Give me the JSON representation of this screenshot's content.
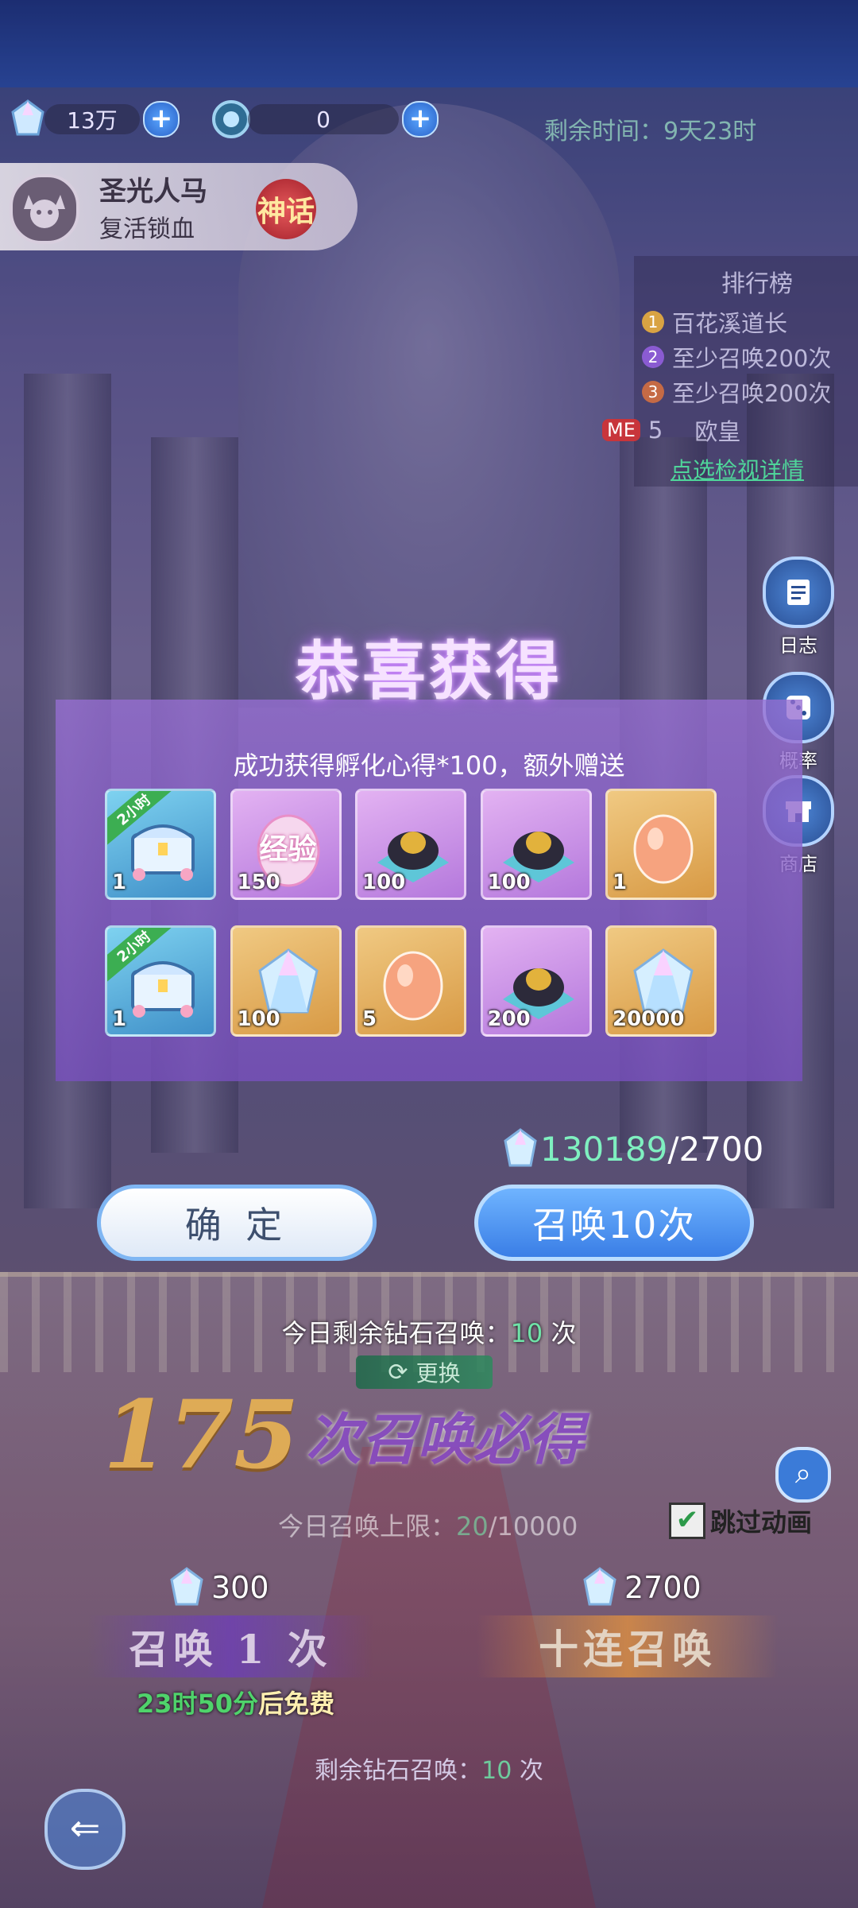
{
  "resources": {
    "gems": "13万",
    "tokens": "0",
    "timer_label": "剩余时间：",
    "timer_value": "9天23时"
  },
  "banner": {
    "name": "圣光人马",
    "subtitle": "复活锁血",
    "rarity": "神话"
  },
  "leaderboard": {
    "title": "排行榜",
    "rows": [
      {
        "rank": "1",
        "name": "百花溪道长",
        "color": "#d9a343"
      },
      {
        "rank": "2",
        "name": "至少召唤200次",
        "color": "#8a5bd2"
      },
      {
        "rank": "3",
        "name": "至少召唤200次",
        "color": "#c56a45"
      }
    ],
    "me_tag": "ME",
    "me_rank": "5",
    "me_name": "欧皇",
    "details_link": "点选检视详情"
  },
  "side_menu": [
    {
      "label": "日志",
      "icon": "log-icon"
    },
    {
      "label": "概率",
      "icon": "dice-icon"
    },
    {
      "label": "商店",
      "icon": "shop-icon"
    }
  ],
  "modal": {
    "title": "恭喜获得",
    "message": "成功获得孵化心得*100，额外赠送",
    "row1": [
      {
        "type": "chest",
        "bg": "blue",
        "count": "1",
        "tag": "2小时"
      },
      {
        "type": "exp-egg",
        "bg": "purple",
        "count": "150",
        "label": "经验"
      },
      {
        "type": "dark-ore",
        "bg": "purple",
        "count": "100"
      },
      {
        "type": "dark-ore",
        "bg": "purple",
        "count": "100"
      },
      {
        "type": "peach-egg",
        "bg": "gold",
        "count": "1"
      }
    ],
    "row2": [
      {
        "type": "chest",
        "bg": "blue",
        "count": "1",
        "tag": "2小时"
      },
      {
        "type": "crystal",
        "bg": "gold",
        "count": "100"
      },
      {
        "type": "peach-egg",
        "bg": "gold",
        "count": "5"
      },
      {
        "type": "dark-ore",
        "bg": "purple",
        "count": "200"
      },
      {
        "type": "crystal",
        "bg": "gold",
        "count": "20000"
      }
    ],
    "crystal_have": "130189",
    "crystal_need": "/2700",
    "confirm_label": "确 定",
    "summon_label": "召唤10次"
  },
  "summon": {
    "today_prefix": "今日剩余钻石召唤：",
    "today_count": "10",
    "today_suffix": " 次",
    "swap_label": "更换",
    "pity_number": "175",
    "pity_text": "次召唤必得",
    "limit_prefix": "今日召唤上限：",
    "limit_used": "20",
    "limit_total": "/10000",
    "skip_label": "跳过动画",
    "cost_single": "300",
    "cost_ten": "2700",
    "single_label": "召唤 1 次",
    "ten_label": "十连召唤",
    "free_time": "23时50分",
    "free_suffix": "后免费",
    "remain_prefix": "剩余钻石召唤：",
    "remain_count": "10",
    "remain_suffix": " 次"
  }
}
